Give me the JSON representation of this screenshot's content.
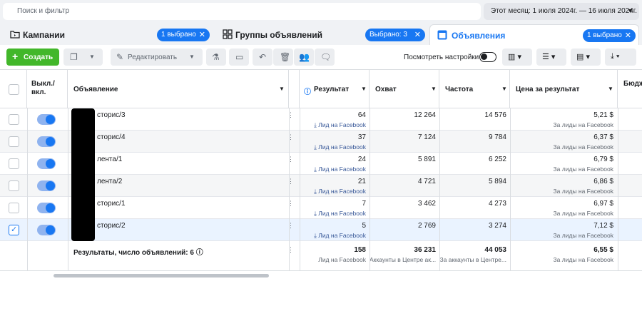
{
  "search": {
    "placeholder": "Поиск и фильтр"
  },
  "date_range": {
    "label": "Этот месяц: 1 июля 2024г. — 16 июля 2024г."
  },
  "tabs": [
    {
      "label": "Кампании",
      "pill": "1 выбрано",
      "icon": "folder-icon"
    },
    {
      "label": "Группы объявлений",
      "pill": "Выбрано: 3",
      "icon": "grid-icon"
    },
    {
      "label": "Объявления",
      "pill": "1 выбрано",
      "icon": "ad-icon"
    }
  ],
  "toolbar": {
    "create_label": "Создать",
    "edit_label": "Редактировать",
    "view_settings_label": "Посмотреть настройки"
  },
  "columns": {
    "toggle": "Выкл./ вкл.",
    "ad": "Объявление",
    "results": "Результат",
    "reach": "Охват",
    "frequency": "Частота",
    "cost": "Цена за результат",
    "budget": "Бюдж"
  },
  "rows": [
    {
      "name": "сторис/3",
      "results": "64",
      "results_type": "Лид на Facebook",
      "reach": "12 264",
      "frequency": "14 576",
      "cost": "5,21 $",
      "cost_type": "За лиды на Facebook",
      "checked": false
    },
    {
      "name": "сторис/4",
      "results": "37",
      "results_type": "Лид на Facebook",
      "reach": "7 124",
      "frequency": "9 784",
      "cost": "6,37 $",
      "cost_type": "За лиды на Facebook",
      "checked": false
    },
    {
      "name": "лента/1",
      "results": "24",
      "results_type": "Лид на Facebook",
      "reach": "5 891",
      "frequency": "6 252",
      "cost": "6,79 $",
      "cost_type": "За лиды на Facebook",
      "checked": false
    },
    {
      "name": "лента/2",
      "results": "21",
      "results_type": "Лид на Facebook",
      "reach": "4 721",
      "frequency": "5 894",
      "cost": "6,86 $",
      "cost_type": "За лиды на Facebook",
      "checked": false
    },
    {
      "name": "сторис/1",
      "results": "7",
      "results_type": "Лид на Facebook",
      "reach": "3 462",
      "frequency": "4 273",
      "cost": "6,97 $",
      "cost_type": "За лиды на Facebook",
      "checked": false
    },
    {
      "name": "сторис/2",
      "results": "5",
      "results_type": "Лид на Facebook",
      "reach": "2 769",
      "frequency": "3 274",
      "cost": "7,12 $",
      "cost_type": "За лиды на Facebook",
      "checked": true
    }
  ],
  "totals": {
    "label": "Результаты, число объявлений: 6",
    "results": "158",
    "results_type": "Лид на Facebook",
    "reach": "36 231",
    "reach_type": "Аккаунты в Центре ак...",
    "frequency": "44 053",
    "frequency_type": "За аккаунты в Центре...",
    "cost": "6,55 $",
    "cost_type": "За лиды на Facebook"
  }
}
